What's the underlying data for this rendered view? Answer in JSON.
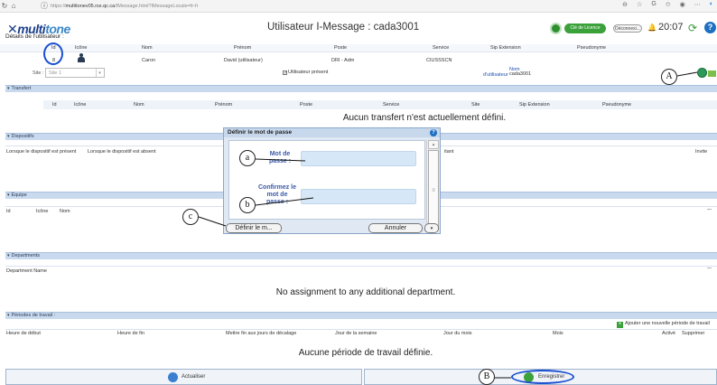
{
  "browser": {
    "url_prefix": "https://",
    "url_host": "multitonev05.rss.qc.ca",
    "url_path": "/IMessage.html?IMessageLocale=fr-fr"
  },
  "header": {
    "logo_a": "multi",
    "logo_b": "tone",
    "subtitle": "Détails de l'utilisateur :",
    "title": "Utilisateur I-Message : cada3001",
    "licence_button": "Clé de Licence",
    "logout_button": "Déconnexi...",
    "time": "20:07"
  },
  "user_table": {
    "headers": [
      "Id",
      "Icône",
      "Nom",
      "Prénom",
      "Poste",
      "Service",
      "Sip Extension",
      "Pseudonyme"
    ],
    "row": {
      "id": "8",
      "nom": "Caron",
      "prenom": "David (utilisateur)",
      "poste": "DRI - Adm",
      "service": "CIUSSSCN"
    },
    "site_label": "Site :",
    "site_value": "Site 1",
    "present_label": "Utilisateur présent",
    "username_label_a": "Nom",
    "username_label_b": "d'utilisateur",
    "username_value": "cada3001"
  },
  "transfert": {
    "title": "Transfert",
    "headers": [
      "Id",
      "Icône",
      "Nom",
      "Prénom",
      "Poste",
      "Service",
      "Site",
      "Sip Extension",
      "Pseudonyme"
    ],
    "empty": "Aucun transfert n'est actuellement défini."
  },
  "dispositifs": {
    "title": "Dispositifs",
    "headers": [
      "Lorsque le dispositif est présent",
      "Lorsque le dispositif est absent",
      "itant",
      "Invite"
    ]
  },
  "equipe": {
    "title": "Équipe",
    "headers": [
      "Id",
      "Icône",
      "Nom"
    ]
  },
  "departments": {
    "title": "Departments",
    "headers": [
      "Department Name"
    ],
    "empty": "No assignment to any additional department."
  },
  "periodes": {
    "title": "Périodes de travail :",
    "add_label": "Ajouter une nouvelle période de travail",
    "headers": [
      "Heure de début",
      "Heure de fin",
      "Mettre fin aux jours de décalage",
      "Jour de la semaine",
      "Jour du mois",
      "Mois",
      "Activé",
      "Supprimer"
    ],
    "empty": "Aucune période de travail définie."
  },
  "dialog": {
    "title": "Définir le mot de passe",
    "label_password": [
      "Mot de",
      "passe :"
    ],
    "label_confirm": [
      "Confirmez le",
      "mot de",
      "passe :"
    ],
    "ok_button": "Définir le m...",
    "cancel_button": "Annuler"
  },
  "footer": {
    "refresh_button": "Actualiser",
    "save_button": "Enregistrer"
  },
  "callouts": {
    "a": "a",
    "b": "b",
    "c": "c",
    "A": "A",
    "B": "B"
  }
}
